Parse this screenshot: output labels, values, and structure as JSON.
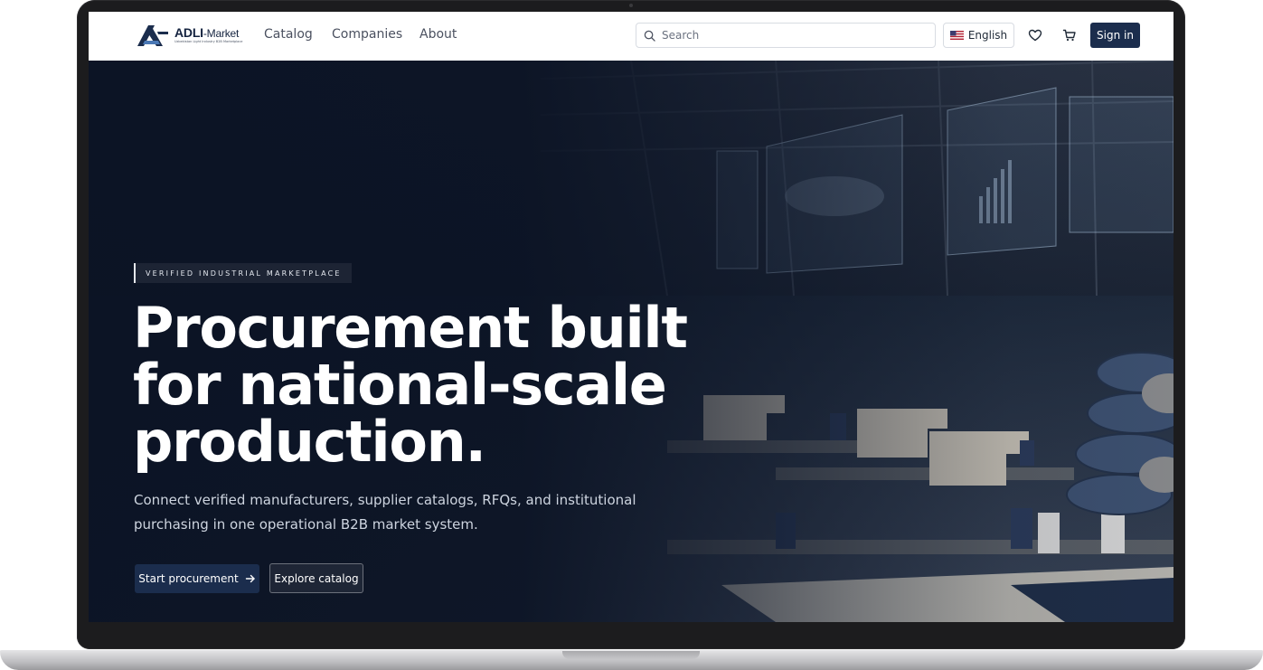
{
  "nav": {
    "logo": {
      "name": "ADLI",
      "suffix": "-Market",
      "tagline": "Uzbekistan Light Industry B2B Marketplace"
    },
    "links": [
      "Catalog",
      "Companies",
      "About"
    ],
    "search": {
      "placeholder": "Search",
      "value": ""
    },
    "language": "English",
    "signin_label": "Sign in"
  },
  "hero": {
    "badge": "VERIFIED INDUSTRIAL MARKETPLACE",
    "headline": "Procurement built for national-scale production.",
    "subtext": "Connect verified manufacturers, supplier catalogs, RFQs, and institutional purchasing in one operational B2B market system.",
    "primary_button": "Start procurement",
    "secondary_button": "Explore catalog",
    "background_image": "textile factory floor with sewing machines, fabric rolls and holographic data dashboards"
  },
  "colors": {
    "brand_navy": "#1b2d4d",
    "hero_dark": "#0b1324",
    "text_light": "#cdd4df"
  }
}
